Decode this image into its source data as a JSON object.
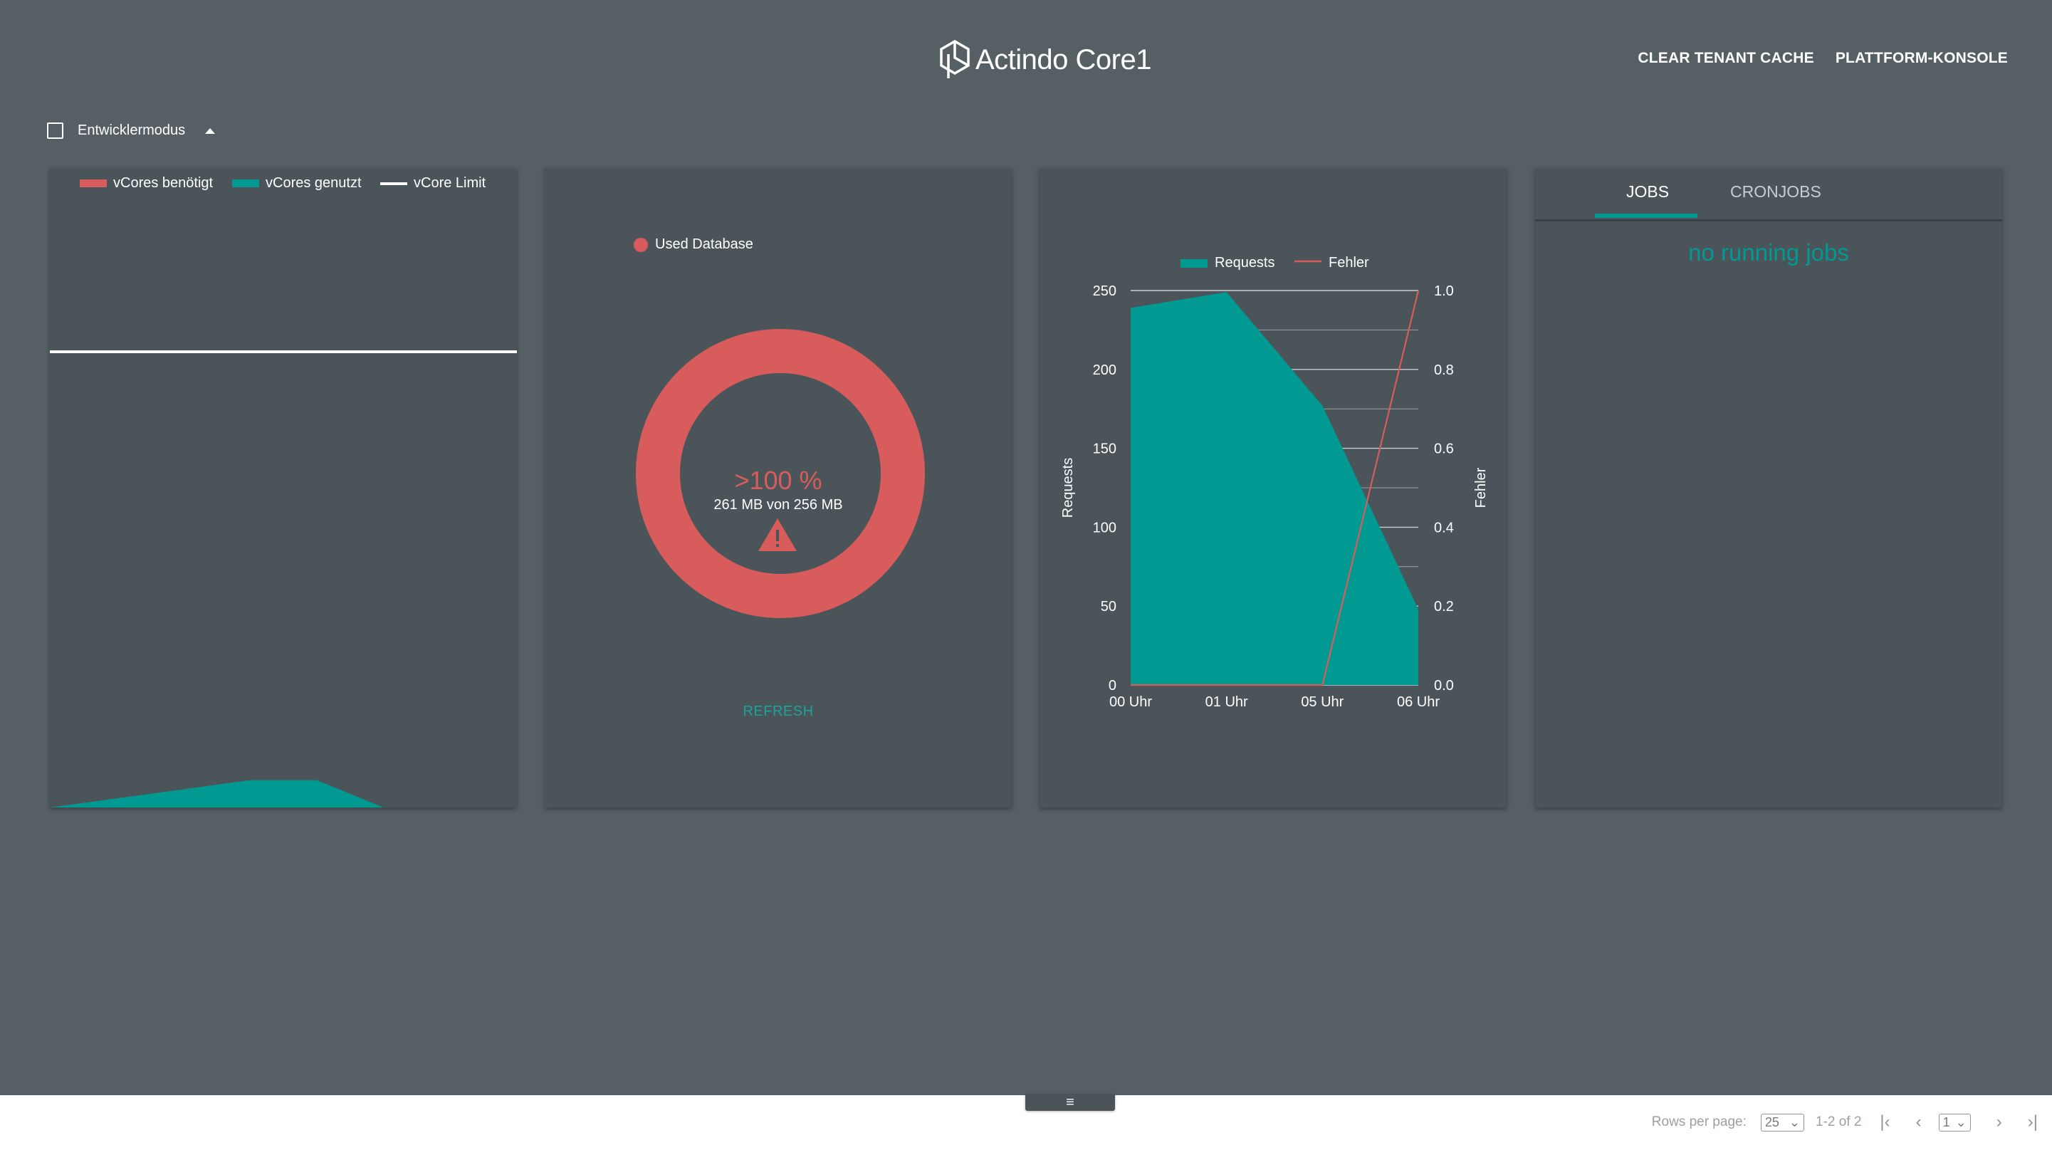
{
  "header": {
    "logo_text": "Actindo Core1",
    "clear_cache_label": "CLEAR TENANT CACHE",
    "platform_console_label": "PLATTFORM-KONSOLE"
  },
  "dev_mode": {
    "label": "Entwicklermodus",
    "checked": false
  },
  "vcores_card": {
    "legend": [
      {
        "label": "vCores benötigt",
        "color": "#d95c5c"
      },
      {
        "label": "vCores genutzt",
        "color": "#009a93"
      },
      {
        "label": "vCore Limit",
        "color": "#ffffff"
      }
    ]
  },
  "database_card": {
    "legend_label": "Used Database",
    "legend_color": "#d95c5c",
    "percent_text": ">100 %",
    "usage_text": "261 MB von 256 MB",
    "refresh_label": "REFRESH",
    "warning_icon": "warning-triangle-icon"
  },
  "requests_card": {
    "legend": [
      {
        "label": "Requests",
        "color": "#009a93"
      },
      {
        "label": "Fehler",
        "color": "#d95c5c"
      }
    ]
  },
  "jobs_card": {
    "tabs": [
      {
        "label": "JOBS",
        "active": true
      },
      {
        "label": "CRONJOBS",
        "active": false
      }
    ],
    "empty_text": "no running jobs"
  },
  "chart_data": [
    {
      "type": "area",
      "title": "",
      "series": [
        {
          "name": "vCores benötigt",
          "values": []
        },
        {
          "name": "vCores genutzt",
          "values": [
            0,
            0.02,
            0.04,
            0.06,
            0.06,
            0,
            0,
            0
          ]
        },
        {
          "name": "vCore Limit",
          "values": [
            1,
            1,
            1,
            1,
            1,
            1,
            1,
            1
          ]
        }
      ]
    },
    {
      "type": "pie",
      "series": [
        {
          "name": "Used Database",
          "values": [
            261
          ]
        }
      ],
      "capacity": 256
    },
    {
      "type": "area",
      "categories": [
        "00 Uhr",
        "01 Uhr",
        "05 Uhr",
        "06 Uhr"
      ],
      "series": [
        {
          "name": "Requests",
          "values": [
            239,
            249,
            177,
            48
          ],
          "axis": "left"
        },
        {
          "name": "Fehler",
          "values": [
            0,
            0,
            0,
            1.0
          ],
          "axis": "right"
        }
      ],
      "ylabel": "Requests",
      "y2label": "Fehler",
      "ylim": [
        0,
        250
      ],
      "y2lim": [
        0,
        1.0
      ],
      "yticks": [
        "0",
        "50",
        "100",
        "150",
        "200",
        "250"
      ],
      "y2ticks": [
        "0.0",
        "0.2",
        "0.4",
        "0.6",
        "0.8",
        "1.0"
      ],
      "grid": true,
      "legend": "top"
    }
  ],
  "footer": {
    "handle_icon": "menu-lines-icon",
    "rows_per_page_label": "Rows per page:",
    "rows_per_page_value": "25",
    "range_text": "1-2 of 2",
    "page_value": "1"
  }
}
